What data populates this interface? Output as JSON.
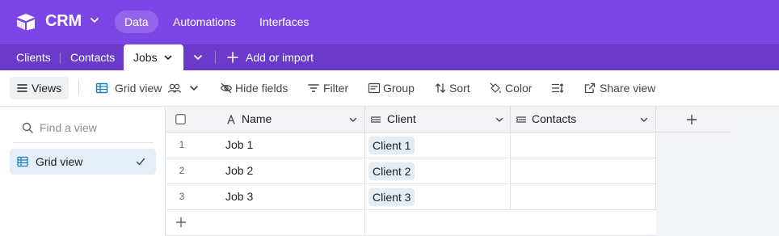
{
  "appbar": {
    "app_name": "CRM",
    "nav": [
      "Data",
      "Automations",
      "Interfaces"
    ],
    "active_nav": "Data",
    "bg_color": "#7c46e6"
  },
  "tables": {
    "tabs": [
      "Clients",
      "Contacts",
      "Jobs"
    ],
    "active_tab": "Jobs",
    "add_label": "Add or import"
  },
  "toolbar": {
    "views_label": "Views",
    "view_name": "Grid view",
    "hide_fields": "Hide fields",
    "filter": "Filter",
    "group": "Group",
    "sort": "Sort",
    "color": "Color",
    "share_view": "Share view"
  },
  "sidebar": {
    "search_placeholder": "Find a view",
    "views": [
      {
        "label": "Grid view",
        "selected": true
      }
    ]
  },
  "grid": {
    "columns": [
      {
        "label": "Name",
        "icon": "text-a-icon"
      },
      {
        "label": "Client",
        "icon": "linked-record-icon"
      },
      {
        "label": "Contacts",
        "icon": "linked-record-icon"
      }
    ],
    "rows": [
      {
        "num": "1",
        "name": "Job 1",
        "client": "Client 1",
        "contacts": ""
      },
      {
        "num": "2",
        "name": "Job 2",
        "client": "Client 2",
        "contacts": ""
      },
      {
        "num": "3",
        "name": "Job 3",
        "client": "Client 3",
        "contacts": ""
      }
    ]
  }
}
